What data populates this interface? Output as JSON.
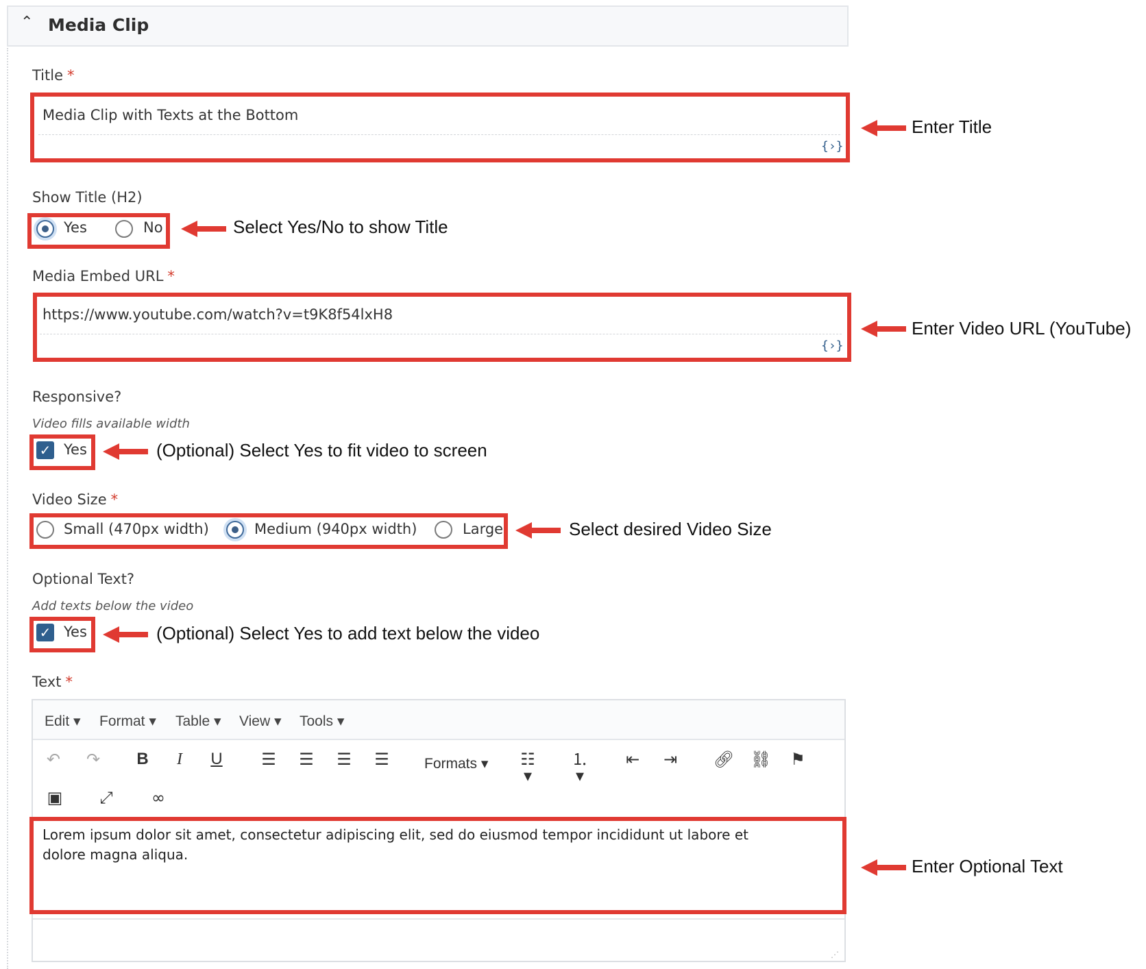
{
  "section": {
    "title": "Media Clip",
    "chevron_icon": "chevron-up-icon"
  },
  "title_field": {
    "label": "Title",
    "required_mark": "*",
    "value": "Media Clip with Texts at the Bottom",
    "source_icon": "source-code-icon"
  },
  "show_title": {
    "label": "Show Title (H2)",
    "options": [
      "Yes",
      "No"
    ],
    "selected": "Yes"
  },
  "embed_url": {
    "label": "Media Embed URL",
    "required_mark": "*",
    "value": "https://www.youtube.com/watch?v=t9K8f54lxH8",
    "source_icon": "source-code-icon"
  },
  "responsive": {
    "label": "Responsive?",
    "hint": "Video fills available width",
    "checkbox_label": "Yes",
    "checked": true
  },
  "video_size": {
    "label": "Video Size",
    "required_mark": "*",
    "options": [
      "Small (470px width)",
      "Medium (940px width)",
      "Large"
    ],
    "selected": "Medium (940px width)"
  },
  "optional_text": {
    "label": "Optional Text?",
    "hint": "Add texts below the video",
    "checkbox_label": "Yes",
    "checked": true
  },
  "text_editor": {
    "label": "Text",
    "required_mark": "*",
    "menu": [
      "Edit",
      "Format",
      "Table",
      "View",
      "Tools"
    ],
    "formats_label": "Formats",
    "toolbar_icons": [
      "undo-icon",
      "redo-icon",
      "bold-icon",
      "italic-icon",
      "underline-icon",
      "align-left-icon",
      "align-center-icon",
      "align-right-icon",
      "align-justify-icon",
      "bullet-list-icon",
      "numbered-list-icon",
      "outdent-icon",
      "indent-icon",
      "link-icon",
      "unlink-icon",
      "bookmark-icon",
      "image-icon",
      "fullscreen-icon",
      "infinity-icon"
    ],
    "content_line1": "Lorem ipsum dolor sit amet, consectetur adipiscing elit, sed do eiusmod tempor incididunt ut labore et",
    "content_line2": "dolore magna aliqua."
  },
  "annotations": {
    "title": "Enter Title",
    "show_title": "Select Yes/No to show Title",
    "url": "Enter Video URL (YouTube)",
    "responsive": "(Optional) Select Yes to fit video to screen",
    "video_size": "Select desired Video Size",
    "optional_text": "(Optional) Select Yes to add text below the video",
    "text": "Enter Optional Text"
  },
  "colors": {
    "annotation_red": "#e03a32",
    "checkbox_blue": "#2f5f8e",
    "required_red": "#d33b2c"
  }
}
